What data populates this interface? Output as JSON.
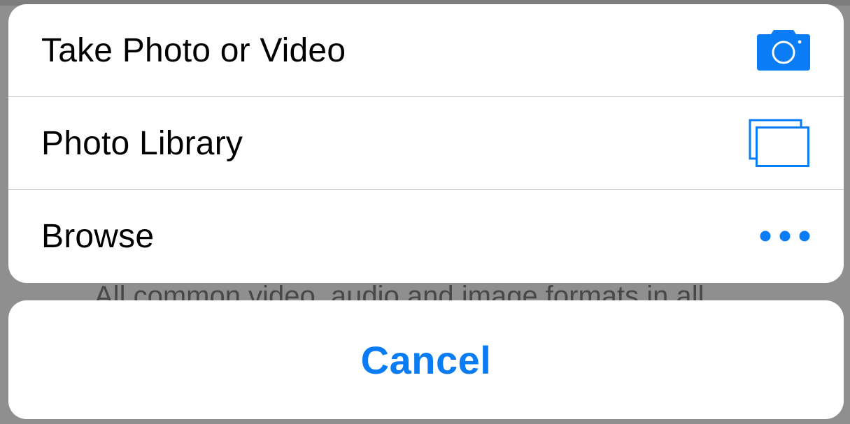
{
  "background": {
    "partial_text": "All common video, audio and image formats in all"
  },
  "action_sheet": {
    "items": [
      {
        "label": "Take Photo or Video",
        "icon": "camera-icon"
      },
      {
        "label": "Photo Library",
        "icon": "photo-library-icon"
      },
      {
        "label": "Browse",
        "icon": "more-icon"
      }
    ],
    "cancel_label": "Cancel"
  },
  "colors": {
    "accent": "#0a7cf5",
    "dim_backdrop": "#8f8f8f",
    "sheet_background": "#ffffff",
    "separator": "#c8c8cc"
  }
}
